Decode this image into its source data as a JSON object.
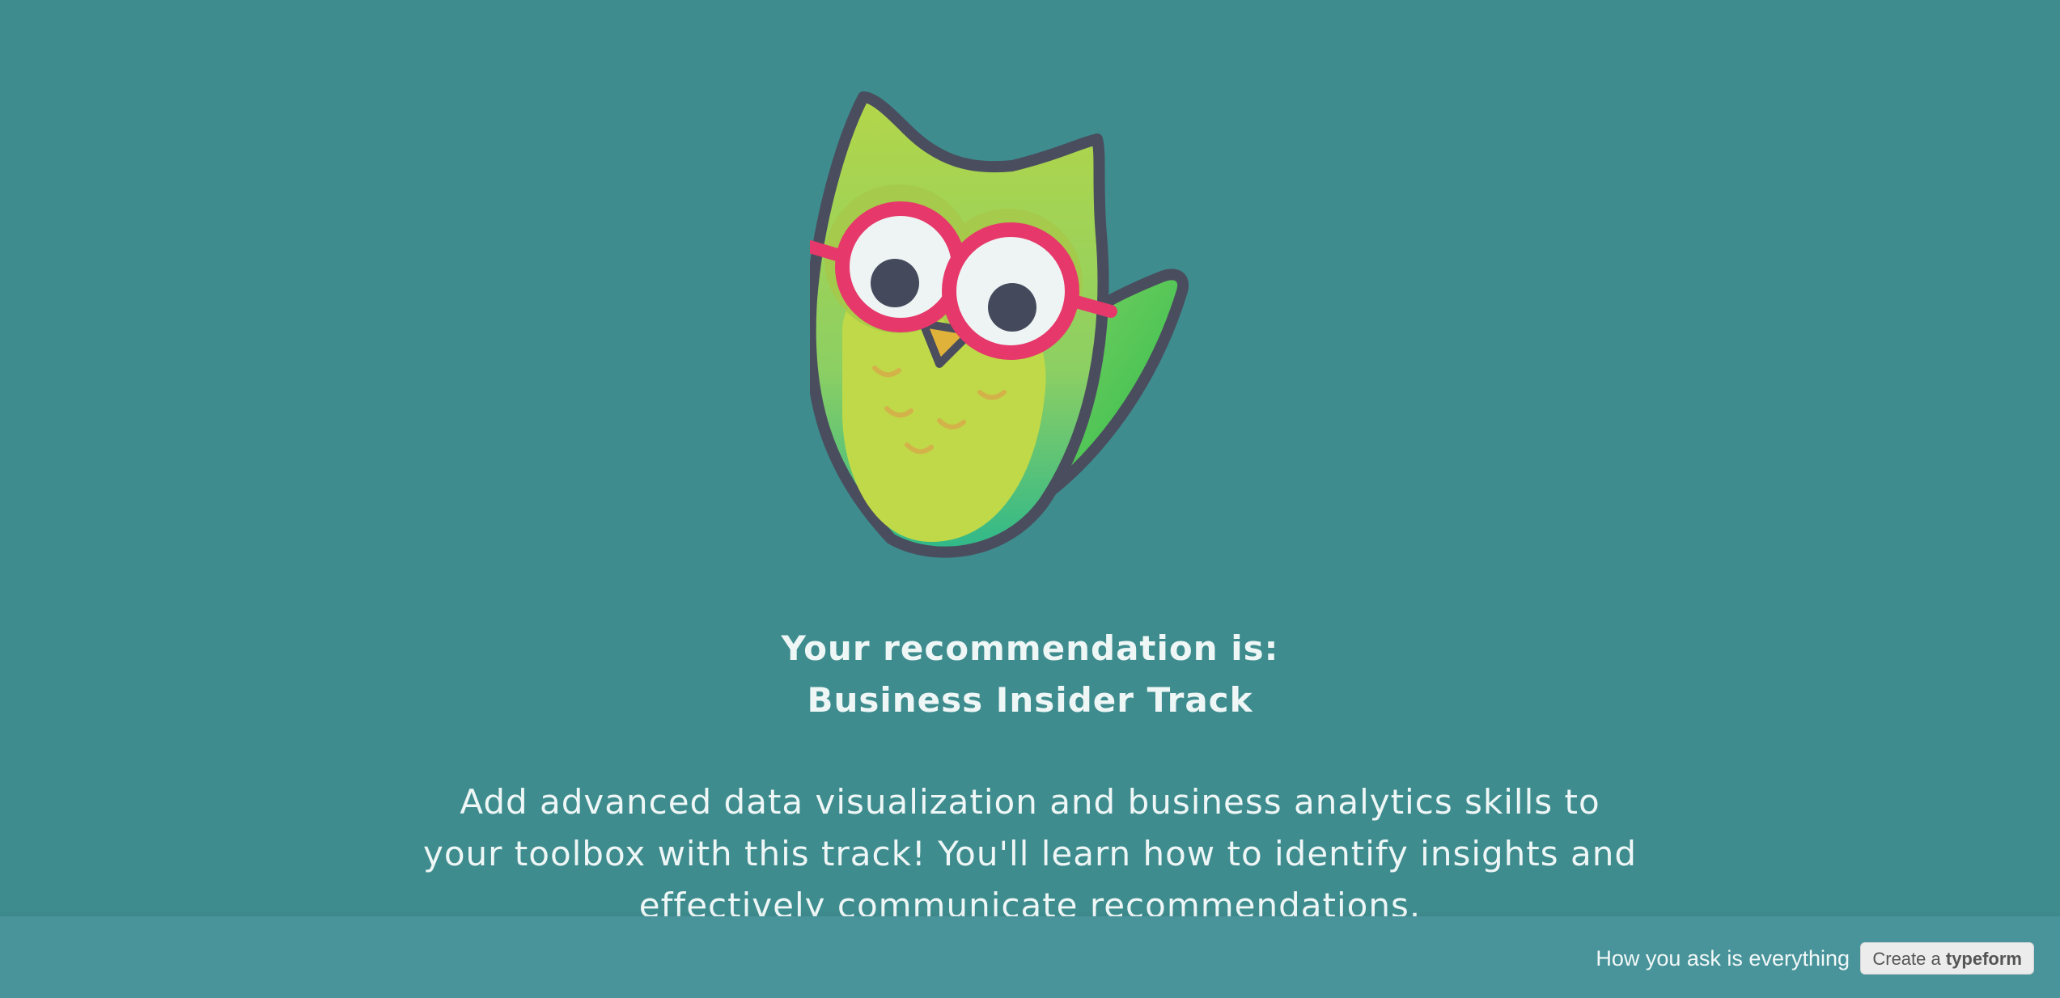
{
  "result": {
    "title_line1": "Your recommendation is:",
    "title_line2": "Business Insider Track",
    "description": "Add advanced data visualization and business analytics skills to your toolbox with this track! You'll learn how to identify insights and effectively communicate recommendations."
  },
  "illustration": {
    "icon": "owl-mascot-icon"
  },
  "footer": {
    "tagline": "How you ask is everything",
    "button_prefix": "Create a",
    "button_brand": "typeform"
  },
  "colors": {
    "background": "#3e8c8e",
    "footer_background": "#48949a",
    "text": "#eef6f6",
    "owl_body": "#c0d948",
    "owl_wing": "#3cc050",
    "owl_outline": "#4a4d5e",
    "glasses": "#e6386a"
  }
}
